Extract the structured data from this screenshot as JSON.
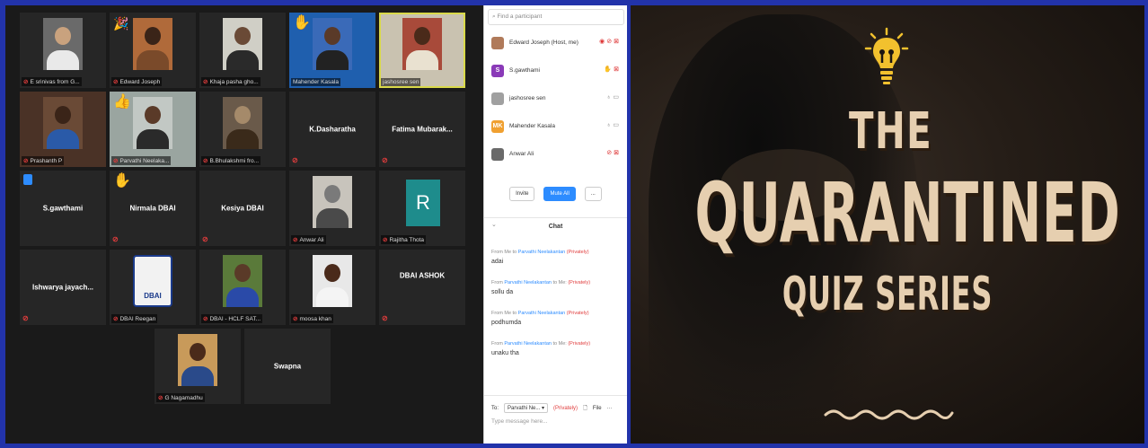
{
  "gallery": {
    "tiles": [
      {
        "name": "E srinivas from G..."
      },
      {
        "name": "Edward Joseph"
      },
      {
        "name": "Khaja pasha gho..."
      },
      {
        "name": "Mahender Kasala"
      },
      {
        "name": "jashosree sen"
      },
      {
        "name": "Prashanth P"
      },
      {
        "name": "Parvathi Neelaka..."
      },
      {
        "name": "B.Bhulakshmi fro..."
      },
      {
        "name": "K.Dasharatha"
      },
      {
        "name": "Fatima Mubarak..."
      },
      {
        "name": "S.gawthami"
      },
      {
        "name": "Nirmala DBAI"
      },
      {
        "name": "Kesiya DBAI"
      },
      {
        "name": "Anwar Ali"
      },
      {
        "name": "Rajitha Thota"
      },
      {
        "name": "Ishwarya jayach..."
      },
      {
        "name": "DBAI Reegan"
      },
      {
        "name": "DBAI - HCLF SAT..."
      },
      {
        "name": "moosa khan"
      },
      {
        "name": "DBAI ASHOK"
      },
      {
        "name": "G Nagamadhu"
      },
      {
        "name": "Swapna"
      }
    ],
    "avatar_letter": "R",
    "dbai_logo_text": "DBAI"
  },
  "panel": {
    "search_placeholder": "Find a participant",
    "participants": [
      {
        "name": "Edward Joseph (Host, me)",
        "initials": ""
      },
      {
        "name": "S.gawthami",
        "initials": "S"
      },
      {
        "name": "jashosree sen",
        "initials": ""
      },
      {
        "name": "Mahender Kasala",
        "initials": "MK"
      },
      {
        "name": "Anwar Ali",
        "initials": ""
      }
    ],
    "invite_label": "Invite",
    "mute_all_label": "Mute All",
    "more_label": "...",
    "chat_title": "Chat",
    "messages": [
      {
        "from": "From Me to",
        "who": "Parvathi Neelakantan",
        "suffix": "",
        "priv": "(Privately)",
        "text": "adai"
      },
      {
        "from": "From",
        "who": "Parvathi Neelakantan",
        "suffix": "to Me:",
        "priv": "(Privately)",
        "text": "sollu da"
      },
      {
        "from": "From Me to",
        "who": "Parvathi Neelakantan",
        "suffix": "",
        "priv": "(Privately)",
        "text": "podhumda"
      },
      {
        "from": "From",
        "who": "Parvathi Neelakantan",
        "suffix": "to Me:",
        "priv": "(Privately)",
        "text": "unaku tha"
      }
    ],
    "to_label": "To:",
    "to_value": "Parvathi Ne... ▾",
    "to_priv": "(Privately)",
    "file_label": "File",
    "type_placeholder": "Type message here..."
  },
  "poster": {
    "line1": "THE",
    "line2": "QUARANTINED",
    "line3": "QUIZ SERIES"
  }
}
